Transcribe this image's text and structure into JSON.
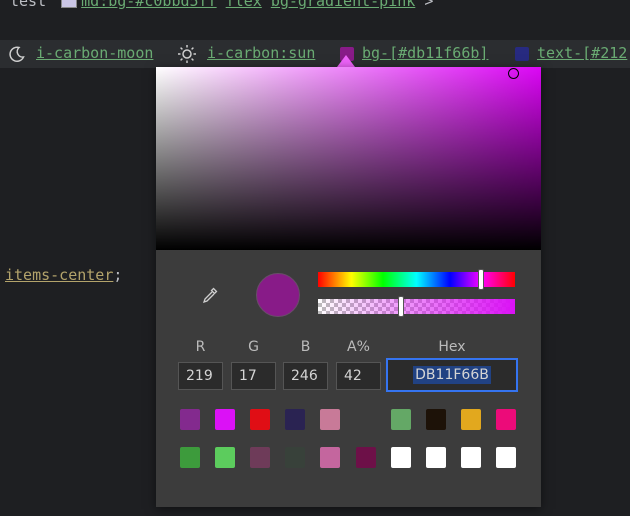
{
  "editor": {
    "top_line": {
      "prefix": "test ",
      "token1": "md:bg-#c0bbd5ff",
      "mid": " ",
      "token2": "flex",
      "sp": " ",
      "token3": "bg-gradient-pink",
      "suffix": " >"
    },
    "hints": [
      {
        "icon": "moon-icon",
        "label": "i-carbon-moon"
      },
      {
        "icon": "sun-icon",
        "label": "i-carbon:sun"
      },
      {
        "swatch": "#881b88",
        "label": "bg-[#db11f66b]"
      },
      {
        "swatch": "#272a80",
        "label": "text-[#212"
      }
    ],
    "items_line": {
      "keyword": "items-center",
      "semicolon": ";"
    }
  },
  "color_picker": {
    "selected_color": "#881b88",
    "hue_color": "#dc06f5",
    "fields": [
      {
        "label": "R",
        "value": "219"
      },
      {
        "label": "G",
        "value": "17"
      },
      {
        "label": "B",
        "value": "246"
      },
      {
        "label": "A%",
        "value": "42"
      }
    ],
    "hex": {
      "label": "Hex",
      "value": "DB11F66B"
    },
    "swatches_row1": [
      "#832a8e",
      "#db11f6",
      "#e00e15",
      "#2a2352",
      "#c87a98",
      "#3c3c3c",
      "#64a866",
      "#1d1208",
      "#e2a81e",
      "#ec0b79"
    ],
    "swatches_row2": [
      "#3d9b3c",
      "#5ccc5d",
      "#6e3b59",
      "#38413a",
      "#c4669e",
      "#6d1048",
      "#ffffff",
      "#ffffff",
      "#ffffff",
      "#ffffff"
    ]
  }
}
